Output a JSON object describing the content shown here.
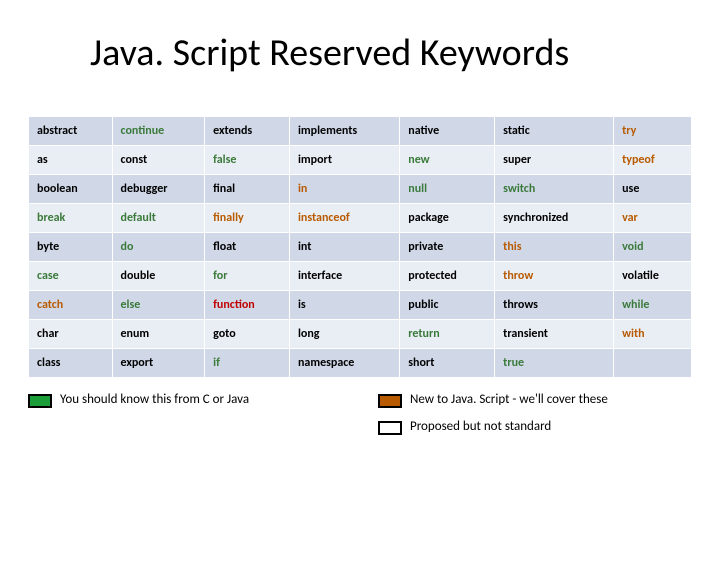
{
  "title": "Java. Script Reserved Keywords",
  "rows": [
    {
      "shade": "dark",
      "cells": [
        {
          "t": "abstract",
          "c": "black"
        },
        {
          "t": "continue",
          "c": "green"
        },
        {
          "t": "extends",
          "c": "black"
        },
        {
          "t": "implements",
          "c": "black"
        },
        {
          "t": "native",
          "c": "black"
        },
        {
          "t": "static",
          "c": "black"
        },
        {
          "t": "try",
          "c": "orange"
        }
      ]
    },
    {
      "shade": "light",
      "cells": [
        {
          "t": "as",
          "c": "black"
        },
        {
          "t": "const",
          "c": "black"
        },
        {
          "t": "false",
          "c": "green"
        },
        {
          "t": "import",
          "c": "black"
        },
        {
          "t": "new",
          "c": "green"
        },
        {
          "t": "super",
          "c": "black"
        },
        {
          "t": "typeof",
          "c": "orange"
        }
      ]
    },
    {
      "shade": "dark",
      "cells": [
        {
          "t": "boolean",
          "c": "black"
        },
        {
          "t": "debugger",
          "c": "black"
        },
        {
          "t": "final",
          "c": "black"
        },
        {
          "t": "in",
          "c": "orange"
        },
        {
          "t": "null",
          "c": "green"
        },
        {
          "t": "switch",
          "c": "green"
        },
        {
          "t": "use",
          "c": "black"
        }
      ]
    },
    {
      "shade": "light",
      "cells": [
        {
          "t": "break",
          "c": "green"
        },
        {
          "t": "default",
          "c": "green"
        },
        {
          "t": "finally",
          "c": "orange"
        },
        {
          "t": "instanceof",
          "c": "orange"
        },
        {
          "t": "package",
          "c": "black"
        },
        {
          "t": "synchronized",
          "c": "black"
        },
        {
          "t": "var",
          "c": "orange"
        }
      ]
    },
    {
      "shade": "dark",
      "cells": [
        {
          "t": "byte",
          "c": "black"
        },
        {
          "t": "do",
          "c": "green"
        },
        {
          "t": "float",
          "c": "black"
        },
        {
          "t": "int",
          "c": "black"
        },
        {
          "t": "private",
          "c": "black"
        },
        {
          "t": "this",
          "c": "orange"
        },
        {
          "t": "void",
          "c": "green"
        }
      ]
    },
    {
      "shade": "light",
      "cells": [
        {
          "t": "case",
          "c": "green"
        },
        {
          "t": "double",
          "c": "black"
        },
        {
          "t": "for",
          "c": "green"
        },
        {
          "t": "interface",
          "c": "black"
        },
        {
          "t": "protected",
          "c": "black"
        },
        {
          "t": "throw",
          "c": "orange"
        },
        {
          "t": "volatile",
          "c": "black"
        }
      ]
    },
    {
      "shade": "dark",
      "cells": [
        {
          "t": "catch",
          "c": "orange"
        },
        {
          "t": "else",
          "c": "green"
        },
        {
          "t": "function",
          "c": "red"
        },
        {
          "t": "is",
          "c": "black"
        },
        {
          "t": "public",
          "c": "black"
        },
        {
          "t": "throws",
          "c": "black"
        },
        {
          "t": "while",
          "c": "green"
        }
      ]
    },
    {
      "shade": "light",
      "cells": [
        {
          "t": "char",
          "c": "black"
        },
        {
          "t": "enum",
          "c": "black"
        },
        {
          "t": "goto",
          "c": "black"
        },
        {
          "t": "long",
          "c": "black"
        },
        {
          "t": "return",
          "c": "green"
        },
        {
          "t": "transient",
          "c": "black"
        },
        {
          "t": "with",
          "c": "orange"
        }
      ]
    },
    {
      "shade": "dark",
      "cells": [
        {
          "t": "class",
          "c": "black"
        },
        {
          "t": "export",
          "c": "black"
        },
        {
          "t": "if",
          "c": "green"
        },
        {
          "t": "namespace",
          "c": "black"
        },
        {
          "t": "short",
          "c": "black"
        },
        {
          "t": "true",
          "c": "green"
        },
        {
          "t": "",
          "c": "black"
        }
      ]
    }
  ],
  "legend": {
    "left": "You should know this from C or Java",
    "right1": "New to Java. Script  - we'll cover these",
    "right2": "Proposed but not standard"
  }
}
